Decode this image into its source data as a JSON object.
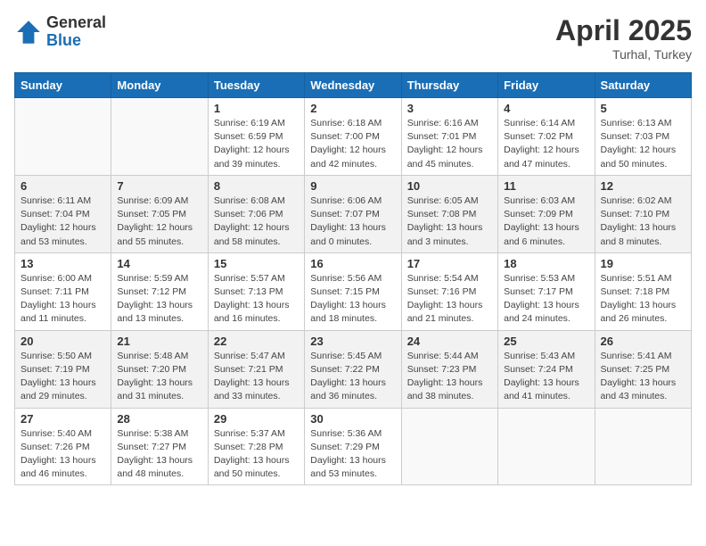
{
  "header": {
    "logo_general": "General",
    "logo_blue": "Blue",
    "month_title": "April 2025",
    "location": "Turhal, Turkey"
  },
  "weekdays": [
    "Sunday",
    "Monday",
    "Tuesday",
    "Wednesday",
    "Thursday",
    "Friday",
    "Saturday"
  ],
  "weeks": [
    {
      "shade": false,
      "days": [
        {
          "num": "",
          "info": ""
        },
        {
          "num": "",
          "info": ""
        },
        {
          "num": "1",
          "info": "Sunrise: 6:19 AM\nSunset: 6:59 PM\nDaylight: 12 hours and 39 minutes."
        },
        {
          "num": "2",
          "info": "Sunrise: 6:18 AM\nSunset: 7:00 PM\nDaylight: 12 hours and 42 minutes."
        },
        {
          "num": "3",
          "info": "Sunrise: 6:16 AM\nSunset: 7:01 PM\nDaylight: 12 hours and 45 minutes."
        },
        {
          "num": "4",
          "info": "Sunrise: 6:14 AM\nSunset: 7:02 PM\nDaylight: 12 hours and 47 minutes."
        },
        {
          "num": "5",
          "info": "Sunrise: 6:13 AM\nSunset: 7:03 PM\nDaylight: 12 hours and 50 minutes."
        }
      ]
    },
    {
      "shade": true,
      "days": [
        {
          "num": "6",
          "info": "Sunrise: 6:11 AM\nSunset: 7:04 PM\nDaylight: 12 hours and 53 minutes."
        },
        {
          "num": "7",
          "info": "Sunrise: 6:09 AM\nSunset: 7:05 PM\nDaylight: 12 hours and 55 minutes."
        },
        {
          "num": "8",
          "info": "Sunrise: 6:08 AM\nSunset: 7:06 PM\nDaylight: 12 hours and 58 minutes."
        },
        {
          "num": "9",
          "info": "Sunrise: 6:06 AM\nSunset: 7:07 PM\nDaylight: 13 hours and 0 minutes."
        },
        {
          "num": "10",
          "info": "Sunrise: 6:05 AM\nSunset: 7:08 PM\nDaylight: 13 hours and 3 minutes."
        },
        {
          "num": "11",
          "info": "Sunrise: 6:03 AM\nSunset: 7:09 PM\nDaylight: 13 hours and 6 minutes."
        },
        {
          "num": "12",
          "info": "Sunrise: 6:02 AM\nSunset: 7:10 PM\nDaylight: 13 hours and 8 minutes."
        }
      ]
    },
    {
      "shade": false,
      "days": [
        {
          "num": "13",
          "info": "Sunrise: 6:00 AM\nSunset: 7:11 PM\nDaylight: 13 hours and 11 minutes."
        },
        {
          "num": "14",
          "info": "Sunrise: 5:59 AM\nSunset: 7:12 PM\nDaylight: 13 hours and 13 minutes."
        },
        {
          "num": "15",
          "info": "Sunrise: 5:57 AM\nSunset: 7:13 PM\nDaylight: 13 hours and 16 minutes."
        },
        {
          "num": "16",
          "info": "Sunrise: 5:56 AM\nSunset: 7:15 PM\nDaylight: 13 hours and 18 minutes."
        },
        {
          "num": "17",
          "info": "Sunrise: 5:54 AM\nSunset: 7:16 PM\nDaylight: 13 hours and 21 minutes."
        },
        {
          "num": "18",
          "info": "Sunrise: 5:53 AM\nSunset: 7:17 PM\nDaylight: 13 hours and 24 minutes."
        },
        {
          "num": "19",
          "info": "Sunrise: 5:51 AM\nSunset: 7:18 PM\nDaylight: 13 hours and 26 minutes."
        }
      ]
    },
    {
      "shade": true,
      "days": [
        {
          "num": "20",
          "info": "Sunrise: 5:50 AM\nSunset: 7:19 PM\nDaylight: 13 hours and 29 minutes."
        },
        {
          "num": "21",
          "info": "Sunrise: 5:48 AM\nSunset: 7:20 PM\nDaylight: 13 hours and 31 minutes."
        },
        {
          "num": "22",
          "info": "Sunrise: 5:47 AM\nSunset: 7:21 PM\nDaylight: 13 hours and 33 minutes."
        },
        {
          "num": "23",
          "info": "Sunrise: 5:45 AM\nSunset: 7:22 PM\nDaylight: 13 hours and 36 minutes."
        },
        {
          "num": "24",
          "info": "Sunrise: 5:44 AM\nSunset: 7:23 PM\nDaylight: 13 hours and 38 minutes."
        },
        {
          "num": "25",
          "info": "Sunrise: 5:43 AM\nSunset: 7:24 PM\nDaylight: 13 hours and 41 minutes."
        },
        {
          "num": "26",
          "info": "Sunrise: 5:41 AM\nSunset: 7:25 PM\nDaylight: 13 hours and 43 minutes."
        }
      ]
    },
    {
      "shade": false,
      "days": [
        {
          "num": "27",
          "info": "Sunrise: 5:40 AM\nSunset: 7:26 PM\nDaylight: 13 hours and 46 minutes."
        },
        {
          "num": "28",
          "info": "Sunrise: 5:38 AM\nSunset: 7:27 PM\nDaylight: 13 hours and 48 minutes."
        },
        {
          "num": "29",
          "info": "Sunrise: 5:37 AM\nSunset: 7:28 PM\nDaylight: 13 hours and 50 minutes."
        },
        {
          "num": "30",
          "info": "Sunrise: 5:36 AM\nSunset: 7:29 PM\nDaylight: 13 hours and 53 minutes."
        },
        {
          "num": "",
          "info": ""
        },
        {
          "num": "",
          "info": ""
        },
        {
          "num": "",
          "info": ""
        }
      ]
    }
  ]
}
